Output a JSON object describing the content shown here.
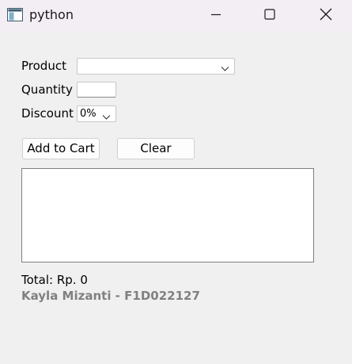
{
  "window": {
    "title": "python",
    "app_icon": "python-window-icon",
    "controls": [
      "minimize-icon",
      "maximize-icon",
      "close-icon"
    ]
  },
  "form": {
    "product_label": "Product",
    "product_value": "",
    "quantity_label": "Quantity",
    "quantity_value": "",
    "discount_label": "Discount",
    "discount_value": "0%"
  },
  "buttons": {
    "add_label": "Add to Cart",
    "clear_label": "Clear"
  },
  "cart": {
    "items": []
  },
  "summary": {
    "total_text": "Total: Rp. 0",
    "author_text": "Kayla Mizanti - F1D022127"
  },
  "colors": {
    "titlebar_bg": "#f3eef4",
    "window_bg": "#f0f0f0",
    "author_text": "#808080"
  }
}
